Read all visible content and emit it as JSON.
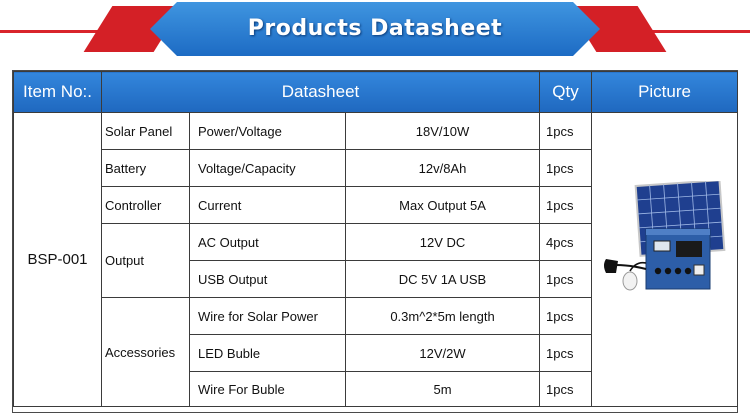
{
  "banner": {
    "title": "Products Datasheet"
  },
  "headers": {
    "item": "Item No:.",
    "datasheet": "Datasheet",
    "qty": "Qty",
    "picture": "Picture"
  },
  "item_no": "BSP-001",
  "rows": [
    {
      "category": "Solar Panel",
      "parameter": "Power/Voltage",
      "value": "18V/10W",
      "qty": "1pcs"
    },
    {
      "category": "Battery",
      "parameter": "Voltage/Capacity",
      "value": "12v/8Ah",
      "qty": "1pcs"
    },
    {
      "category": "Controller",
      "parameter": "Current",
      "value": "Max Output 5A",
      "qty": "1pcs"
    },
    {
      "category": "Output",
      "parameter": "AC Output",
      "value": "12V DC",
      "qty": "4pcs"
    },
    {
      "category": "",
      "parameter": "USB Output",
      "value": "DC 5V 1A USB",
      "qty": "1pcs"
    },
    {
      "category": "Accessories",
      "parameter": "Wire for Solar Power",
      "value": "0.3m^2*5m length",
      "qty": "1pcs"
    },
    {
      "category": "",
      "parameter": "LED Buble",
      "value": "12V/2W",
      "qty": "1pcs"
    },
    {
      "category": "",
      "parameter": "Wire For Buble",
      "value": "5m",
      "qty": "1pcs"
    }
  ],
  "colors": {
    "banner_blue": "#2b7ad2",
    "banner_red": "#d42026",
    "header_blue": "#2b7ad2"
  },
  "picture_icon": "solar-kit-photo"
}
